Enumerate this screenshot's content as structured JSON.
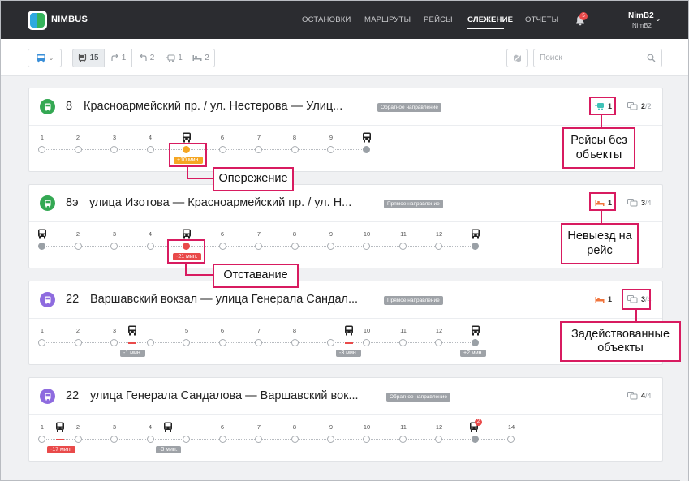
{
  "app": {
    "brand": "NIMBUS",
    "nav": [
      {
        "label": "ОСТАНОВКИ",
        "active": false
      },
      {
        "label": "МАРШРУТЫ",
        "active": false
      },
      {
        "label": "РЕЙСЫ",
        "active": false
      },
      {
        "label": "СЛЕЖЕНИЕ",
        "active": true
      },
      {
        "label": "ОТЧЕТЫ",
        "active": false
      }
    ],
    "notifications": "5",
    "user": {
      "name": "NimB2",
      "sub": "NimB2"
    }
  },
  "toolbar": {
    "filters": [
      {
        "icon": "bus-icon",
        "count": "15"
      },
      {
        "icon": "route-forward-icon",
        "count": "1"
      },
      {
        "icon": "route-back-icon",
        "count": "2"
      },
      {
        "icon": "bus-no-object-icon",
        "count": "1"
      },
      {
        "icon": "bed-icon",
        "count": "2"
      }
    ],
    "search_placeholder": "Поиск"
  },
  "colors": {
    "route_green": "#34a853",
    "route_purple": "#8e6bdf",
    "ahead": "#f5a623",
    "late": "#e94a4a",
    "neutral": "#9ea2a7",
    "callout": "#d81b60"
  },
  "routes": [
    {
      "number": "8",
      "title": "Красноармейский пр. / ул. Нестерова — Улиц...",
      "direction": "Обратное направление",
      "stat_a": {
        "icon": "bus-no-object-icon",
        "value": "1"
      },
      "stat_b": {
        "icon": "vehicles-icon",
        "used": "2",
        "total": "/2"
      },
      "stops": [
        "1",
        "2",
        "3",
        "4",
        "",
        "6",
        "7",
        "8",
        "9",
        ""
      ],
      "deviations": [
        "+10 мин."
      ]
    },
    {
      "number": "8э",
      "title": "улица Изотова — Красноармейский пр. / ул. Н...",
      "direction": "Прямое направление",
      "stat_a": {
        "icon": "bed-icon",
        "value": "1"
      },
      "stat_b": {
        "icon": "vehicles-icon",
        "used": "3",
        "total": "/4"
      },
      "stops": [
        "",
        "2",
        "3",
        "4",
        "",
        "6",
        "7",
        "8",
        "9",
        "10",
        "11",
        "12",
        ""
      ],
      "deviations": [
        "-21 мин."
      ]
    },
    {
      "number": "22",
      "title": "Варшавский вокзал — улица Генерала Сандал...",
      "direction": "Прямое направление",
      "stat_a": {
        "icon": "bed-icon",
        "value": "1"
      },
      "stat_b": {
        "icon": "vehicles-icon",
        "used": "3",
        "total": "/4"
      },
      "stops": [
        "1",
        "2",
        "3",
        "",
        "5",
        "6",
        "7",
        "8",
        "",
        "10",
        "11",
        "12",
        ""
      ],
      "deviations": [
        "-1 мин.",
        "-3 мин.",
        "+2 мин."
      ]
    },
    {
      "number": "22",
      "title": "улица Генерала Сандалова — Варшавский вок...",
      "direction": "Обратное направление",
      "stat_b": {
        "icon": "vehicles-icon",
        "used": "4",
        "total": "/4"
      },
      "stops": [
        "1",
        "",
        "2",
        "3",
        "4",
        "",
        "6",
        "7",
        "8",
        "9",
        "10",
        "11",
        "12",
        "",
        "14"
      ],
      "bus_badge": "2",
      "deviations": [
        "-17 мин.",
        "-3 мин."
      ]
    }
  ],
  "callouts": [
    {
      "text": "Рейсы без объекты"
    },
    {
      "text": "Опережение"
    },
    {
      "text": "Невыезд на рейс"
    },
    {
      "text": "Отставание"
    },
    {
      "text": "Задействованные объекты"
    }
  ]
}
